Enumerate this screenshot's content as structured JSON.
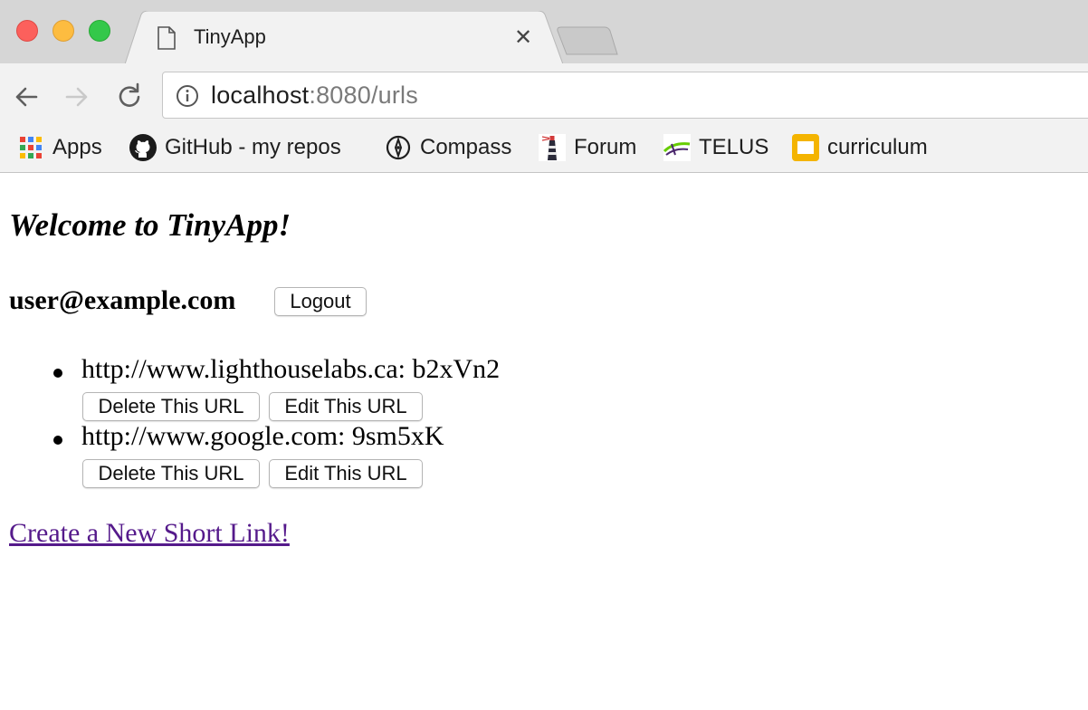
{
  "browser": {
    "tab_title": "TinyApp",
    "address": {
      "host": "localhost",
      "rest": ":8080/urls"
    },
    "bookmarks": [
      {
        "label": "Apps",
        "icon": "apps-grid-icon"
      },
      {
        "label": "GitHub - my repos",
        "icon": "github-icon"
      },
      {
        "label": "Compass",
        "icon": "compass-icon"
      },
      {
        "label": "Forum",
        "icon": "lighthouse-icon"
      },
      {
        "label": "TELUS",
        "icon": "telus-icon"
      },
      {
        "label": "curriculum",
        "icon": "slides-icon"
      }
    ]
  },
  "page": {
    "heading": "Welcome to TinyApp!",
    "user_email": "user@example.com",
    "logout_label": "Logout",
    "urls": [
      {
        "text": "http://www.lighthouselabs.ca: b2xVn2",
        "delete_label": "Delete This URL",
        "edit_label": "Edit This URL"
      },
      {
        "text": "http://www.google.com: 9sm5xK",
        "delete_label": "Delete This URL",
        "edit_label": "Edit This URL"
      }
    ],
    "create_link": "Create a New Short Link!"
  },
  "colors": {
    "visited_link": "#551a8b",
    "close_light": "#fc605c",
    "minimize_light": "#fdbc40",
    "maximize_light": "#34c84a"
  }
}
